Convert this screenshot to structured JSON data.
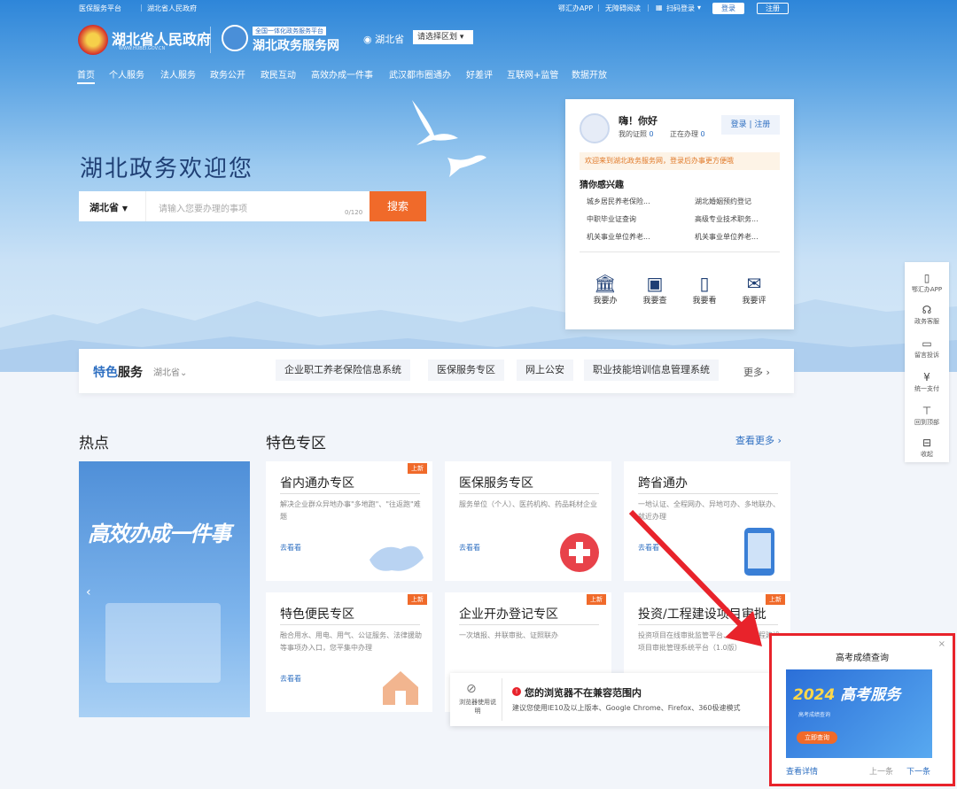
{
  "topbar": {
    "left": [
      "医保服务平台",
      "湖北省人民政府"
    ],
    "app": "鄂汇办APP",
    "barrier": "无障碍阅读",
    "scan": "扫码登录",
    "login": "登录",
    "register": "注册"
  },
  "header": {
    "gov_name": "湖北省人民政府",
    "gov_url": "WWW.HUBEI.GOV.CN",
    "platform_tag": "全国一体化政务服务平台",
    "platform_name": "湖北政务服务网",
    "location": "湖北省",
    "region_select": "请选择区划"
  },
  "nav": [
    "首页",
    "个人服务",
    "法人服务",
    "政务公开",
    "政民互动",
    "高效办成一件事",
    "武汉都市圈通办",
    "好差评",
    "互联网+监管",
    "数据开放"
  ],
  "hero": {
    "welcome": "湖北政务欢迎您"
  },
  "search": {
    "province": "湖北省",
    "placeholder": "请输入您要办理的事项",
    "count": "0/120",
    "button": "搜索"
  },
  "user_card": {
    "greeting": "嗨！你好",
    "cert_label": "我的证照",
    "cert_count": "0",
    "doing_label": "正在办理",
    "doing_count": "0",
    "login": "登录",
    "register": "注册",
    "notice": "欢迎来到湖北政务服务网，登录后办事更方便哦",
    "interest_title": "猜你感兴趣",
    "interests": [
      "城乡居民养老保险...",
      "湖北婚姻预约登记",
      "中职毕业证查询",
      "高级专业技术职务...",
      "机关事业单位养老...",
      "机关事业单位养老..."
    ],
    "actions": [
      {
        "label": "我要办",
        "icon": "bank-icon"
      },
      {
        "label": "我要查",
        "icon": "search-doc-icon"
      },
      {
        "label": "我要看",
        "icon": "tablet-icon"
      },
      {
        "label": "我要评",
        "icon": "comment-icon"
      }
    ]
  },
  "featured": {
    "title_a": "特色",
    "title_b": "服务",
    "region": "湖北省",
    "tags": [
      "企业职工养老保险信息系统",
      "医保服务专区",
      "网上公安",
      "职业技能培训信息管理系统"
    ],
    "more": "更多"
  },
  "hot": {
    "title": "热点",
    "banner_text": "高效办成一件事"
  },
  "zones": {
    "title": "特色专区",
    "more": "查看更多",
    "go": "去看看",
    "items": [
      {
        "title": "省内通办专区",
        "desc": "解决企业群众异地办事\"多地跑\"、\"往返跑\"难题",
        "badge": "上新"
      },
      {
        "title": "医保服务专区",
        "desc": "服务单位（个人）、医药机构、药品耗材企业",
        "badge": ""
      },
      {
        "title": "跨省通办",
        "desc": "一地认证、全程网办、异地可办、多地联办、就近办理",
        "badge": ""
      },
      {
        "title": "特色便民专区",
        "desc": "融合用水、用电、用气、公证服务、法律援助等事项办入口，您平集中办理",
        "badge": "上新"
      },
      {
        "title": "企业开办登记专区",
        "desc": "一次填报、并联审批、证照联办",
        "badge": "上新"
      },
      {
        "title": "投资/工程建设项目审批",
        "desc": "投资项目在线审批监管平台、湖北省工程建设项目审批管理系统平台（1.0版）",
        "badge": "上新"
      }
    ]
  },
  "sidebar": [
    {
      "label": "鄂汇办APP",
      "icon": "phone-icon"
    },
    {
      "label": "政务客服",
      "icon": "headset-icon"
    },
    {
      "label": "留言投诉",
      "icon": "message-icon"
    },
    {
      "label": "统一支付",
      "icon": "yuan-icon"
    },
    {
      "label": "回到顶部",
      "icon": "to-top-icon"
    },
    {
      "label": "收起",
      "icon": "collapse-icon"
    }
  ],
  "browser_warning": {
    "title": "您的浏览器不在兼容范围内",
    "detail": "建议您使用IE10及以上版本、Google Chrome、Firefox、360极速模式",
    "guide": "浏览器使用说明"
  },
  "popup": {
    "title": "高考成绩查询",
    "banner_year": "2024",
    "banner_text": "高考服务",
    "banner_sub": "高考成绩查询",
    "banner_btn": "立即查询",
    "detail": "查看详情",
    "prev": "上一条",
    "next": "下一条"
  },
  "colors": {
    "primary": "#2e6fc1",
    "accent": "#f06a2a",
    "alert": "#e8232b"
  }
}
